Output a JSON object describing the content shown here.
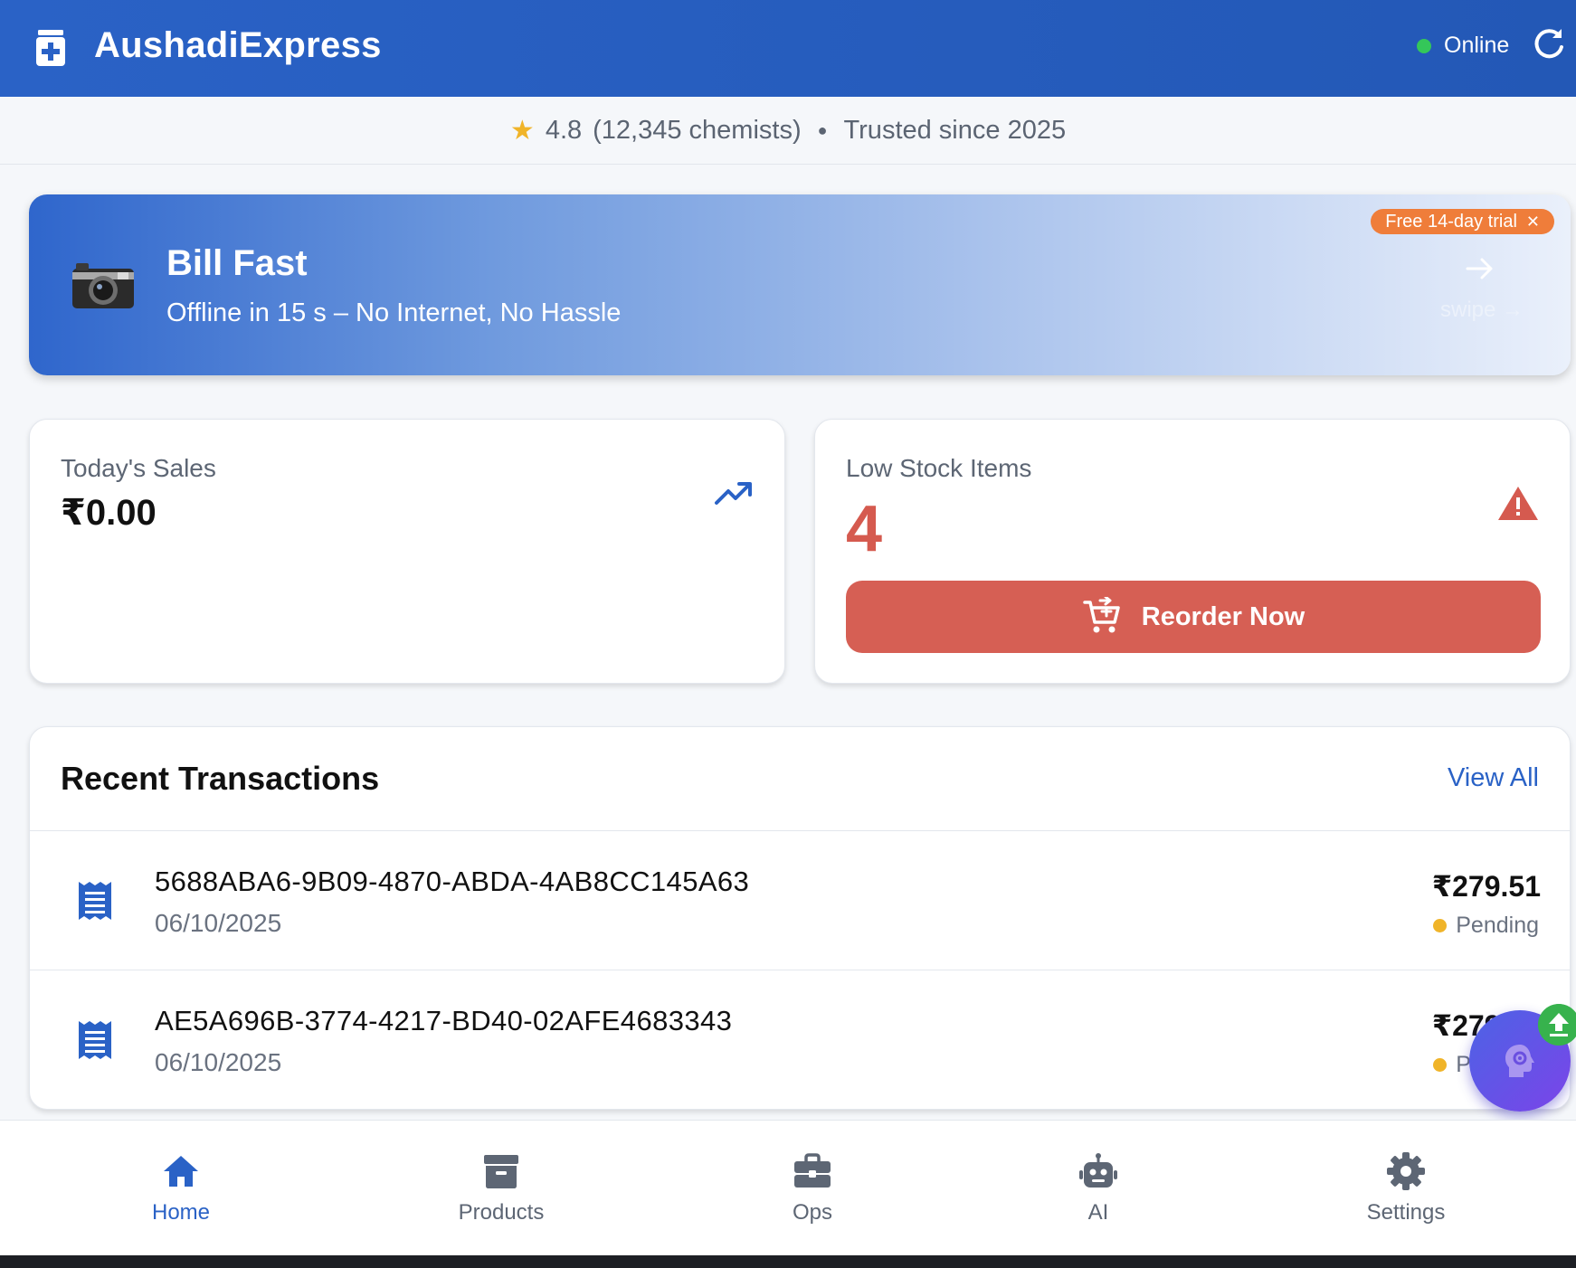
{
  "header": {
    "app_title": "AushadiExpress",
    "status_label": "Online",
    "logo_icon": "medicine-kit-icon",
    "refresh_icon": "refresh-icon"
  },
  "rating": {
    "score": "4.8",
    "count_text": "(12,345 chemists)",
    "trusted_text": "Trusted since 2025"
  },
  "banner": {
    "title": "Bill Fast",
    "subtitle": "Offline in 15 s – No Internet, No Hassle",
    "trial_badge": "Free 14-day trial",
    "swipe_label": "swipe →"
  },
  "sales": {
    "label": "Today's Sales",
    "value": "₹0.00"
  },
  "low_stock": {
    "label": "Low Stock Items",
    "value": "4",
    "button_label": "Reorder Now"
  },
  "transactions": {
    "title": "Recent Transactions",
    "view_all_label": "View All",
    "rows": [
      {
        "id": "5688ABA6-9B09-4870-ABDA-4AB8CC145A63",
        "date": "06/10/2025",
        "amount": "₹279.51",
        "status": "Pending"
      },
      {
        "id": "AE5A696B-3774-4217-BD40-02AFE4683343",
        "date": "06/10/2025",
        "amount": "₹279.51",
        "status": "Pending"
      }
    ]
  },
  "bottom_nav": {
    "items": [
      {
        "label": "Home",
        "icon": "home-icon",
        "active": true
      },
      {
        "label": "Products",
        "icon": "archive-box-icon",
        "active": false
      },
      {
        "label": "Ops",
        "icon": "briefcase-icon",
        "active": false
      },
      {
        "label": "AI",
        "icon": "robot-icon",
        "active": false
      },
      {
        "label": "Settings",
        "icon": "gear-icon",
        "active": false
      }
    ]
  },
  "colors": {
    "primary": "#2a62c6",
    "danger": "#d65f54",
    "online": "#34c759",
    "pending": "#f0b429",
    "trial": "#ef7d3a"
  }
}
